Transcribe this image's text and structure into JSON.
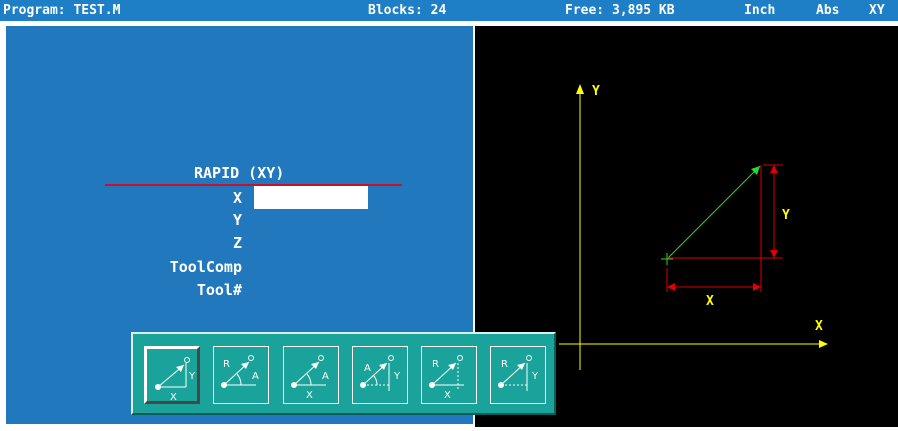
{
  "status_bar": {
    "program": "Program: TEST.M",
    "blocks": "Blocks: 24",
    "free": "Free: 3,895 KB",
    "units": "Inch",
    "mode": "Abs",
    "plane": "XY"
  },
  "form": {
    "title": "RAPID (XY)",
    "fields": [
      "X",
      "Y",
      "Z",
      "ToolComp",
      "Tool#"
    ],
    "x_value": ""
  },
  "graphic": {
    "y_axis_label": "Y",
    "x_axis_label": "X",
    "dim_y_label": "Y",
    "dim_x_label": "X",
    "colors": {
      "axis": "#ffff00",
      "move": "#2bd82b",
      "dimension": "#e00000",
      "label": "#ffff00"
    }
  },
  "toolbar": {
    "buttons": [
      {
        "icon": "rapid-xy-icon",
        "labels": [
          "Y",
          "X"
        ],
        "active": true
      },
      {
        "icon": "rapid-radius-angle-icon",
        "labels": [
          "R",
          "A"
        ],
        "active": false
      },
      {
        "icon": "rapid-x-angle-icon",
        "labels": [
          "X",
          "A"
        ],
        "active": false
      },
      {
        "icon": "rapid-angle-y-icon",
        "labels": [
          "A",
          "Y"
        ],
        "active": false
      },
      {
        "icon": "rapid-radius-x-icon",
        "labels": [
          "R",
          "X"
        ],
        "active": false
      },
      {
        "icon": "rapid-radius-y-icon",
        "labels": [
          "R",
          "Y"
        ],
        "active": false
      }
    ]
  }
}
